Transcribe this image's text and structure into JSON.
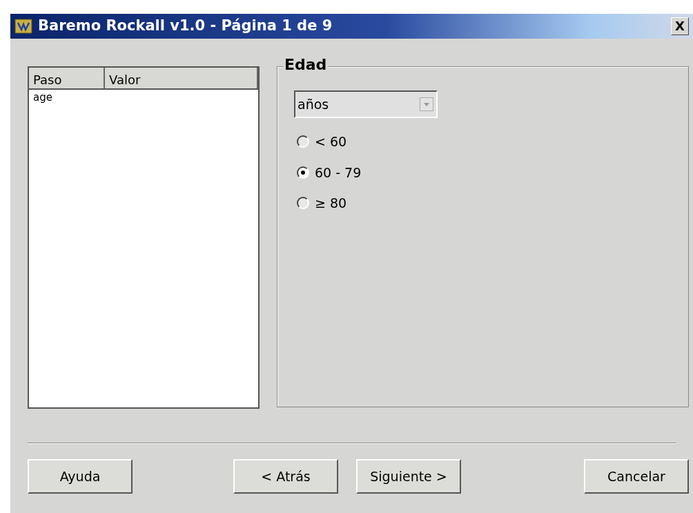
{
  "window": {
    "title": "Baremo Rockall v1.0 - Página 1 de 9",
    "close": "X"
  },
  "table": {
    "columns": [
      "Paso",
      "Valor"
    ],
    "rows": [
      [
        "age",
        ""
      ]
    ]
  },
  "group": {
    "title": "Edad",
    "dropdown": {
      "value": "años"
    },
    "options": [
      {
        "label": "< 60",
        "selected": false
      },
      {
        "label": "60 - 79",
        "selected": true
      },
      {
        "label": "≥ 80",
        "selected": false
      }
    ]
  },
  "buttons": [
    {
      "label": "Ayuda",
      "kind": "left"
    },
    {
      "label": "< Atrás",
      "kind": "nav"
    },
    {
      "label": "Siguiente >",
      "kind": "nav"
    },
    {
      "label": "Cancelar",
      "kind": "right"
    }
  ]
}
